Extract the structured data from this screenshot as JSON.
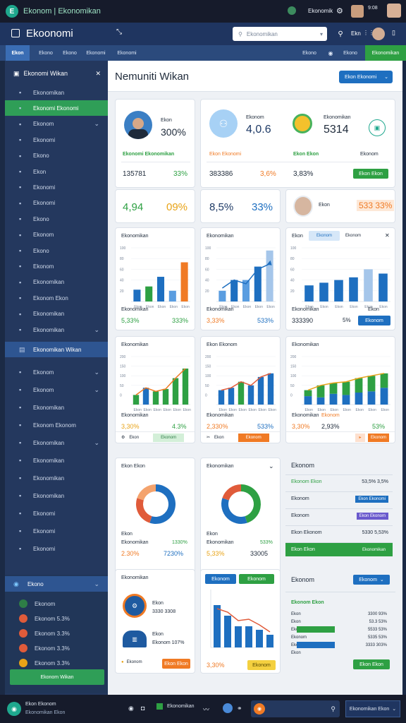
{
  "os": {
    "title": "Ekonom | Ekonomikan",
    "time": "9:08",
    "status_label": "Ekonomik"
  },
  "app": {
    "name": "Ekoonomi",
    "search_placeholder": "Ekonomikan",
    "user_label": "Ekn"
  },
  "nav": {
    "tabs": [
      "Ekon",
      "Ekono",
      "Ekono",
      "Ekonomi",
      "Ekonomi"
    ],
    "right_tabs": [
      "Ekono",
      "Ekono"
    ],
    "active_right": "Ekonomikan"
  },
  "sidebar": {
    "header": "Ekonomi Wikan",
    "items": [
      {
        "label": "Ekonomikan",
        "chev": false,
        "icon": "grid-icon"
      },
      {
        "label": "Ekonomi Ekonomi",
        "chev": false,
        "icon": "chart-icon",
        "active": true
      },
      {
        "label": "Ekonom",
        "chev": true,
        "icon": "folder-icon"
      },
      {
        "label": "Ekonomi",
        "chev": false,
        "icon": "doc-icon"
      },
      {
        "label": "Ekono",
        "chev": false,
        "icon": "circle-icon"
      },
      {
        "label": "Ekon",
        "chev": false,
        "icon": "tag-icon"
      },
      {
        "label": "Ekonomi",
        "chev": false,
        "icon": "lock-icon"
      },
      {
        "label": "Ekonomi",
        "chev": false,
        "icon": "flag-icon"
      },
      {
        "label": "Ekono",
        "chev": false,
        "icon": "alert-icon"
      },
      {
        "label": "Ekonom",
        "chev": false,
        "icon": "calendar-icon"
      },
      {
        "label": "Ekono",
        "chev": false,
        "icon": "inbox-icon"
      },
      {
        "label": "Ekonom",
        "chev": false,
        "icon": "star-icon"
      },
      {
        "label": "Ekonomikan",
        "chev": false,
        "icon": "user-icon"
      },
      {
        "label": "Ekonom Ekon",
        "chev": false,
        "icon": "mail-icon"
      },
      {
        "label": "Ekonomikan",
        "chev": false,
        "icon": "share-icon"
      },
      {
        "label": "Ekonomikan",
        "chev": true,
        "icon": "tools-icon"
      }
    ],
    "section_label": "Ekonomikan Wikan",
    "group2": [
      {
        "label": "Ekonom",
        "chev": true,
        "icon": "box-icon"
      },
      {
        "label": "Ekonom",
        "chev": true,
        "icon": "person-icon"
      },
      {
        "label": "Ekonomikan",
        "chev": false,
        "icon": "shield-icon"
      },
      {
        "label": "Ekonom Ekonom",
        "chev": false,
        "icon": "layers-icon"
      },
      {
        "label": "Ekonomikan",
        "chev": true,
        "icon": "archive-icon"
      },
      {
        "label": "Ekonomikan",
        "chev": false,
        "icon": "globe-icon"
      },
      {
        "label": "Ekonomikan",
        "chev": false,
        "icon": "cart-icon"
      },
      {
        "label": "Ekonomikan",
        "chev": false,
        "icon": "clock-icon"
      },
      {
        "label": "Ekonomi",
        "chev": false,
        "icon": "bell-icon"
      },
      {
        "label": "Ekonomi",
        "chev": false,
        "icon": "print-icon"
      },
      {
        "label": "Ekonomi",
        "chev": false,
        "icon": "file-icon"
      }
    ],
    "group3_header": "Ekono",
    "group3": [
      {
        "label": "Ekonom"
      },
      {
        "label": "Ekonom 5.3%"
      },
      {
        "label": "Ekonom 3.3%"
      },
      {
        "label": "Ekonom 3.3%"
      },
      {
        "label": "Ekonom 3.3%"
      }
    ],
    "bottom_btn": "Ekonom Wikan"
  },
  "page": {
    "title": "Nemuniti Wikan",
    "action": "Ekon Ekonomi"
  },
  "kpi": {
    "c1": {
      "label": "Ekon",
      "value": "300%",
      "sub": "Ekonomi Ekonomikan",
      "a": "135781",
      "b": "33%"
    },
    "c2": {
      "label": "Ekonom",
      "value": "4,0.6",
      "sub": "Ekon Ekonomi",
      "a": "383386",
      "b": "3,6%"
    },
    "c3": {
      "label": "Ekonomikan",
      "value": "5314",
      "sub1": "Ekon Ekon",
      "sub2": "Ekonom",
      "a": "3,83%",
      "btn": "Ekon Ekon"
    },
    "r2a": {
      "a": "4,94",
      "b": "09%"
    },
    "r2b": {
      "a": "8,5%",
      "b": "33%"
    },
    "r2c": {
      "label": "Ekon",
      "value": "533 33%"
    }
  },
  "charts": [
    {
      "title": "Ekonomikan",
      "footer": "Ekonomikan",
      "v1": "5,33%",
      "v2": "333%",
      "y": [
        "100",
        "80",
        "60",
        "40",
        "20"
      ],
      "x": [
        "Ekon",
        "Ekon",
        "Ekon",
        "Ekon",
        "Ekon",
        "Ekon",
        "Ekon"
      ]
    },
    {
      "title": "Ekonomikan",
      "footer": "Ekonomikan",
      "v1": "3,33%",
      "v2": "533%",
      "y": [
        "100",
        "80",
        "60",
        "40",
        "20"
      ],
      "x": [
        "Ekon",
        "Ekon",
        "Ekon",
        "Ekon",
        "Ekon",
        "Ekon"
      ]
    },
    {
      "title": "Ekon",
      "tab": "Ekonom",
      "tab2": "Ekonom",
      "footer": "Ekonomikan",
      "footer2": "Ekon",
      "v1": "333390",
      "v2": "5%",
      "btn": "Ekonom",
      "y": [
        "100",
        "80",
        "60",
        "40",
        "20"
      ],
      "x": [
        "Ekon",
        "Ekon",
        "Ekon",
        "Ekon",
        "Ekon",
        "Ekon"
      ]
    },
    {
      "title": "Ekonomikan",
      "footer": "Ekonomikan",
      "v1": "3,30%",
      "v2": "4.3%",
      "y": [
        "200",
        "150",
        "100",
        "50",
        "0"
      ],
      "x": [
        "Ekon",
        "Ekon",
        "Ekon",
        "Ekon",
        "Ekon",
        "Ekon"
      ],
      "b1": "Ekon",
      "b2": "Ekonom"
    },
    {
      "title": "Ekon Ekonom",
      "footer": "Ekonomikan",
      "v1": "2,330%",
      "v2": "533%",
      "y": [
        "200",
        "150",
        "100",
        "50",
        "0"
      ],
      "x": [
        "Ekon",
        "Ekon",
        "Ekon",
        "Ekon",
        "Ekon",
        "Ekon"
      ],
      "b1": "Ekon",
      "b2": "Ekonom"
    },
    {
      "title": "Ekonomikan",
      "footer": "Ekonomikan",
      "footer2": "Ekonom",
      "v1": "3,30%",
      "v2": "2,93%",
      "v3": "53%",
      "y": [
        "200",
        "150",
        "100",
        "50",
        "0"
      ],
      "x": [
        "Ekon",
        "Ekon",
        "Ekon",
        "Ekon",
        "Ekon",
        "Ekon",
        "Ekon"
      ],
      "b2": "Ekonom"
    }
  ],
  "chart_data": [
    {
      "type": "bar",
      "categories": [
        "Ekon",
        "Ekon",
        "Ekon",
        "Ekon",
        "Ekon"
      ],
      "values": [
        22,
        28,
        46,
        20,
        73
      ],
      "ylim": [
        0,
        100
      ]
    },
    {
      "type": "bar",
      "categories": [
        "Ekon",
        "Ekon",
        "Ekon",
        "Ekon",
        "Ekon"
      ],
      "series": [
        {
          "values": [
            25,
            40,
            33,
            60,
            70
          ]
        },
        {
          "values": [
            20,
            40,
            40,
            65,
            95
          ]
        }
      ],
      "ylim": [
        0,
        100
      ]
    },
    {
      "type": "bar",
      "categories": [
        "Ekon",
        "Ekon",
        "Ekon",
        "Ekon",
        "Ekon",
        "Ekon"
      ],
      "values": [
        30,
        35,
        40,
        45,
        60,
        52
      ],
      "ylim": [
        0,
        100
      ]
    },
    {
      "type": "bar",
      "categories": [
        "Ekon",
        "Ekon",
        "Ekon",
        "Ekon",
        "Ekon",
        "Ekon"
      ],
      "series": [
        {
          "values": [
            10,
            25,
            30,
            25,
            40,
            70
          ]
        },
        {
          "values": [
            40,
            70,
            55,
            65,
            110,
            150
          ]
        }
      ],
      "ylim": [
        0,
        200
      ]
    },
    {
      "type": "bar",
      "categories": [
        "Ekon",
        "Ekon",
        "Ekon",
        "Ekon",
        "Ekon",
        "Ekon"
      ],
      "series": [
        {
          "values": [
            40,
            55,
            50,
            60,
            50,
            110
          ]
        },
        {
          "values": [
            60,
            70,
            95,
            80,
            115,
            130
          ]
        }
      ],
      "ylim": [
        0,
        200
      ]
    },
    {
      "type": "bar",
      "categories": [
        "Ekon",
        "Ekon",
        "Ekon",
        "Ekon",
        "Ekon",
        "Ekon",
        "Ekon"
      ],
      "series": [
        {
          "values": [
            35,
            30,
            45,
            40,
            50,
            55,
            70
          ]
        },
        {
          "values": [
            60,
            80,
            90,
            95,
            110,
            120,
            130
          ]
        }
      ],
      "ylim": [
        0,
        200
      ]
    },
    {
      "type": "pie",
      "values": [
        55,
        25,
        20
      ],
      "labels": [
        "Ekon",
        "Ekon",
        "Ekon"
      ]
    },
    {
      "type": "pie",
      "values": [
        45,
        35,
        20
      ],
      "labels": [
        "Ekon",
        "Ekon",
        "Ekon"
      ]
    }
  ],
  "donuts": [
    {
      "title": "Ekon Ekon",
      "label": "Ekon",
      "sub": "Ekonomikan",
      "v1": "2.30%",
      "v2": "7230%",
      "stat": "1330%"
    },
    {
      "title": "Ekonomikan",
      "label": "Ekon",
      "sub": "Ekonomikan",
      "v1": "5,33%",
      "v2": "33005",
      "stat": "533%"
    }
  ],
  "list": {
    "title": "Ekonom",
    "rows": [
      {
        "label": "Ekonom Ekon",
        "value": "53,5% 3,5%",
        "btn": ""
      },
      {
        "label": "Ekonom",
        "value": "",
        "btn": "Ekon Ekonomi"
      },
      {
        "label": "Ekonom",
        "value": "",
        "btn": "Ekon Ekonom"
      },
      {
        "label": "Ekon Ekonom",
        "value": "5330 5,53%",
        "btn": ""
      },
      {
        "label": "Ekon Ekon",
        "value": "",
        "btn": "Ekonomikan"
      }
    ]
  },
  "profile": {
    "title": "Ekonomikan",
    "l1": "Ekon",
    "l2": "3330 3308",
    "l3": "Ekon",
    "l4": "Ekonom 107%",
    "l5": "Ekonom",
    "btn": "Ekon Ekon"
  },
  "lineChart": {
    "btn1": "Ekonom",
    "btn2": "Ekonom",
    "footer": "3,30%",
    "btn3": "Ekonom"
  },
  "right_bottom": {
    "title": "Ekonom",
    "btn": "Ekonom",
    "head": "Ekonom Ekon",
    "rows": [
      {
        "label": "Ekon",
        "value": "3300 93%"
      },
      {
        "label": "Ekon",
        "value": "53.3 53%"
      },
      {
        "label": "Ekon",
        "value": "5533 53%"
      },
      {
        "label": "Ekonom",
        "value": "5335 53%"
      },
      {
        "label": "Ekonom",
        "value": "3333 303%"
      },
      {
        "label": "Ekon",
        "value": ""
      }
    ],
    "btn2": "Ekon Ekon"
  },
  "footer": {
    "brand": "Ekon Ekonom",
    "sub": "Ekonomikan Ekon",
    "btn": "Ekonomikan",
    "right": "Ekonomikan Ekon"
  }
}
